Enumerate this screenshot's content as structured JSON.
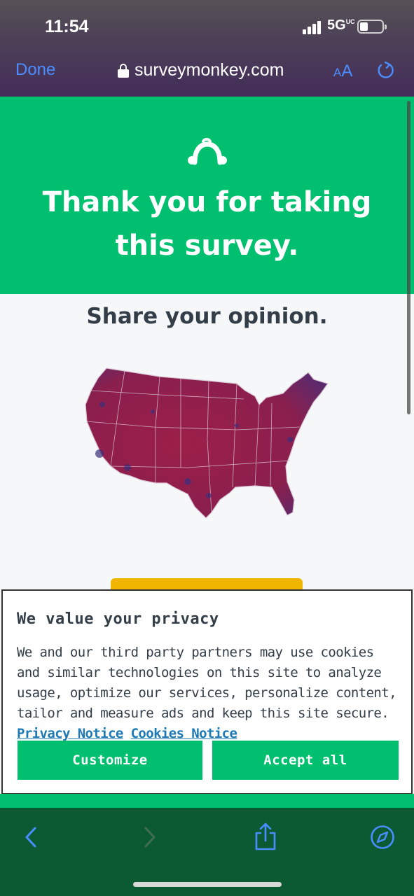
{
  "status_bar": {
    "time": "11:54",
    "network": "5G",
    "network_sup": "UC"
  },
  "browser": {
    "done_label": "Done",
    "url": "surveymonkey.com",
    "text_size_small": "A",
    "text_size_large": "A"
  },
  "page": {
    "thank_you": "Thank you for taking this survey.",
    "share_heading": "Share your opinion."
  },
  "privacy": {
    "title": "We value your privacy",
    "body": "We and our third party partners may use cookies and similar technologies on this site to analyze usage, optimize our services, personalize content, tailor and measure ads and keep this site secure.",
    "privacy_link": "Privacy Notice",
    "cookies_link": "Cookies Notice",
    "customize_label": "Customize",
    "accept_label": "Accept all"
  },
  "colors": {
    "brand_green": "#00bf6f",
    "link_blue": "#1c79b3",
    "ios_blue": "#4a8dff",
    "cta_yellow": "#f0b500"
  },
  "toolbar_icons": [
    "back-icon",
    "forward-icon",
    "share-icon",
    "compass-icon"
  ]
}
